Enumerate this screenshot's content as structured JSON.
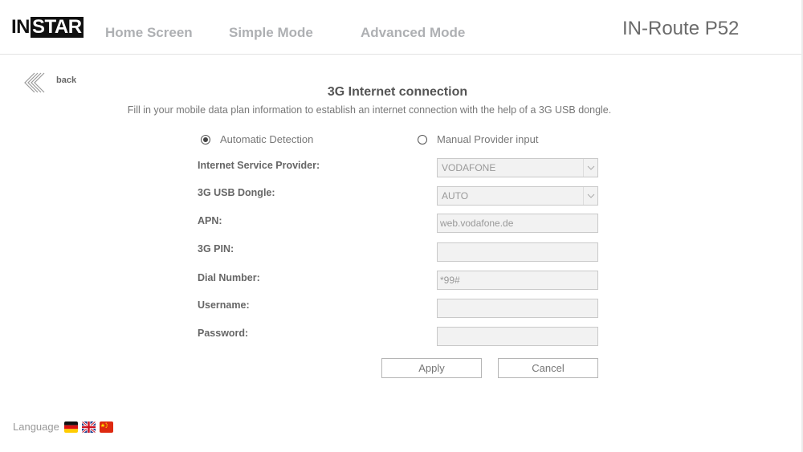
{
  "header": {
    "logo_in": "IN",
    "logo_star": "STAR",
    "nav": [
      "Home Screen",
      "Simple Mode",
      "Advanced Mode"
    ],
    "product": "IN-Route P52"
  },
  "back_label": "back",
  "page": {
    "title": "3G Internet connection",
    "description": "Fill in your mobile data plan information to establish an internet connection with the help of a 3G USB dongle."
  },
  "mode": {
    "automatic": "Automatic Detection",
    "manual": "Manual Provider input",
    "selected": "automatic"
  },
  "form": {
    "isp_label": "Internet Service Provider:",
    "isp_value": "VODAFONE",
    "dongle_label": "3G USB Dongle:",
    "dongle_value": "AUTO",
    "apn_label": "APN:",
    "apn_value": "web.vodafone.de",
    "pin_label": "3G PIN:",
    "pin_value": "",
    "dial_label": "Dial Number:",
    "dial_value": "*99#",
    "username_label": "Username:",
    "username_value": "",
    "password_label": "Password:",
    "password_value": ""
  },
  "buttons": {
    "apply": "Apply",
    "cancel": "Cancel"
  },
  "language": {
    "label": "Language",
    "flags": [
      "german-flag-icon",
      "uk-flag-icon",
      "china-flag-icon"
    ]
  }
}
